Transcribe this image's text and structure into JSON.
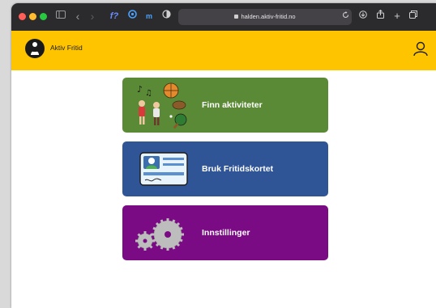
{
  "browser": {
    "url": "halden.aktiv-fritid.no"
  },
  "app": {
    "brand": "Aktiv Fritid",
    "accent_color": "#fec400"
  },
  "cards": [
    {
      "label": "Finn aktiviteter",
      "color": "#5a8a35",
      "icon": "activities-icon"
    },
    {
      "label": "Bruk Fritidskortet",
      "color": "#2f5597",
      "icon": "card-icon"
    },
    {
      "label": "Innstillinger",
      "color": "#7b0a85",
      "icon": "gears-icon"
    }
  ],
  "icons": {
    "user": "user-icon",
    "logo": "logo-icon"
  }
}
